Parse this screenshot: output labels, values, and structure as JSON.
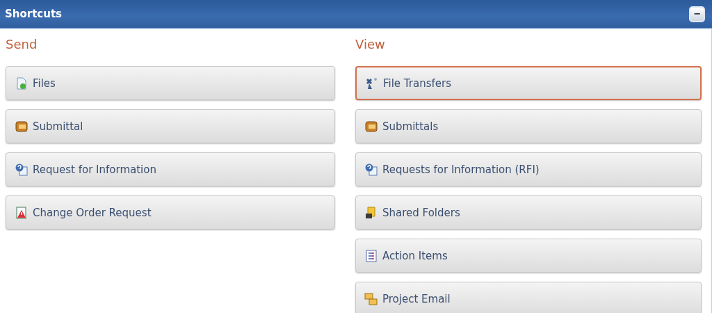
{
  "panel": {
    "title": "Shortcuts",
    "collapse_button": {
      "label": "−"
    }
  },
  "columns": [
    {
      "heading": "Send",
      "items": [
        {
          "label": "Files",
          "kind": "file",
          "selected": false
        },
        {
          "label": "Submittal",
          "kind": "submittal",
          "selected": false
        },
        {
          "label": "Request for Information",
          "kind": "rfi",
          "selected": false
        },
        {
          "label": "Change Order Request",
          "kind": "change",
          "selected": false
        }
      ]
    },
    {
      "heading": "View",
      "items": [
        {
          "label": "File Transfers",
          "kind": "transfer",
          "selected": true
        },
        {
          "label": "Submittals",
          "kind": "submittal",
          "selected": false
        },
        {
          "label": "Requests for Information (RFI)",
          "kind": "rfi",
          "selected": false
        },
        {
          "label": "Shared Folders",
          "kind": "folder",
          "selected": false
        },
        {
          "label": "Action Items",
          "kind": "list",
          "selected": false
        },
        {
          "label": "Project Email",
          "kind": "email",
          "selected": false
        }
      ]
    }
  ]
}
